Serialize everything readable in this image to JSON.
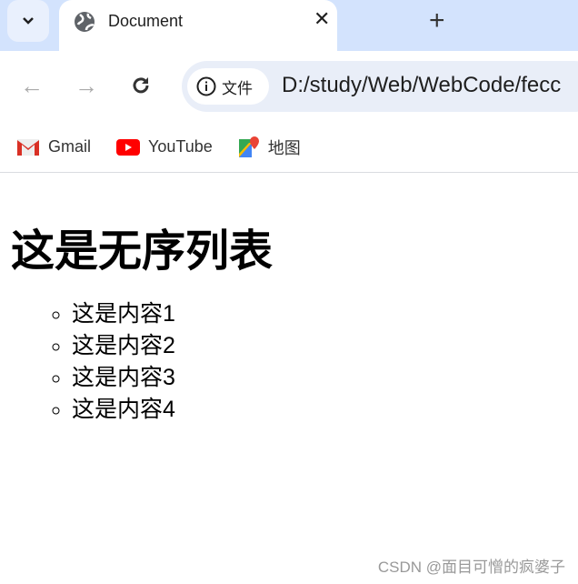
{
  "browser": {
    "tab_title": "Document",
    "security_label": "文件",
    "url": "D:/study/Web/WebCode/fecc",
    "bookmarks": [
      {
        "label": "Gmail",
        "icon": "gmail-icon"
      },
      {
        "label": "YouTube",
        "icon": "youtube-icon"
      },
      {
        "label": "地图",
        "icon": "maps-icon"
      }
    ]
  },
  "page": {
    "heading": "这是无序列表",
    "items": [
      "这是内容1",
      "这是内容2",
      "这是内容3",
      "这是内容4"
    ]
  },
  "watermark": "CSDN @面目可憎的疯婆子"
}
